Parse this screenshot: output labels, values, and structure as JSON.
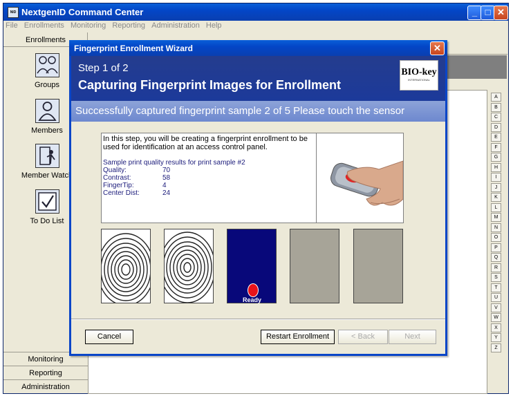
{
  "app": {
    "title": "NextgenID Command Center",
    "icon_text": "NID",
    "menu": [
      "File",
      "Enrollments",
      "Monitoring",
      "Reporting",
      "Administration",
      "Help"
    ]
  },
  "window_controls": {
    "minimize": "_",
    "maximize": "□",
    "close": "✕"
  },
  "left_panel": {
    "header": "Enrollments",
    "items": [
      {
        "label": "Groups",
        "icon": "groups-icon"
      },
      {
        "label": "Members",
        "icon": "member-icon"
      },
      {
        "label": "Member Watch",
        "icon": "member-watch-icon"
      },
      {
        "label": "To Do List",
        "icon": "checkbox-icon"
      }
    ],
    "bottom": [
      "Monitoring",
      "Reporting",
      "Administration"
    ]
  },
  "alphabet": [
    "A",
    "B",
    "C",
    "D",
    "E",
    "F",
    "G",
    "H",
    "I",
    "J",
    "K",
    "L",
    "M",
    "N",
    "O",
    "P",
    "Q",
    "R",
    "S",
    "T",
    "U",
    "V",
    "W",
    "X",
    "Y",
    "Z"
  ],
  "dialog": {
    "title": "Fingerprint Enrollment Wizard",
    "close": "✕",
    "step": "Step 1 of 2",
    "heading": "Capturing Fingerprint Images for Enrollment",
    "logo_main": "BIO-key",
    "logo_sub": "INTERNATIONAL",
    "status": "Successfully captured fingerprint sample 2 of 5  Please touch the sensor",
    "intro": "In this step, you will be creating a fingerprint enrollment to be used for identification at an access control panel.",
    "quality_heading": "Sample print quality results for print sample #2",
    "quality": [
      {
        "label": "Quality:",
        "value": "70"
      },
      {
        "label": "Contrast:",
        "value": "58"
      },
      {
        "label": "FingerTip:",
        "value": "4"
      },
      {
        "label": "Center Dist:",
        "value": "24"
      }
    ],
    "samples": [
      {
        "state": "captured"
      },
      {
        "state": "captured"
      },
      {
        "state": "ready",
        "label": "Ready"
      },
      {
        "state": "empty"
      },
      {
        "state": "empty"
      }
    ],
    "buttons": {
      "cancel": "Cancel",
      "restart": "Restart Enrollment",
      "back": "< Back",
      "next": "Next"
    }
  },
  "colors": {
    "title_blue": "#0346c7",
    "header_blue": "#1c3a9a",
    "status_blue": "#7b92d4",
    "ready_bg": "#08087a"
  }
}
